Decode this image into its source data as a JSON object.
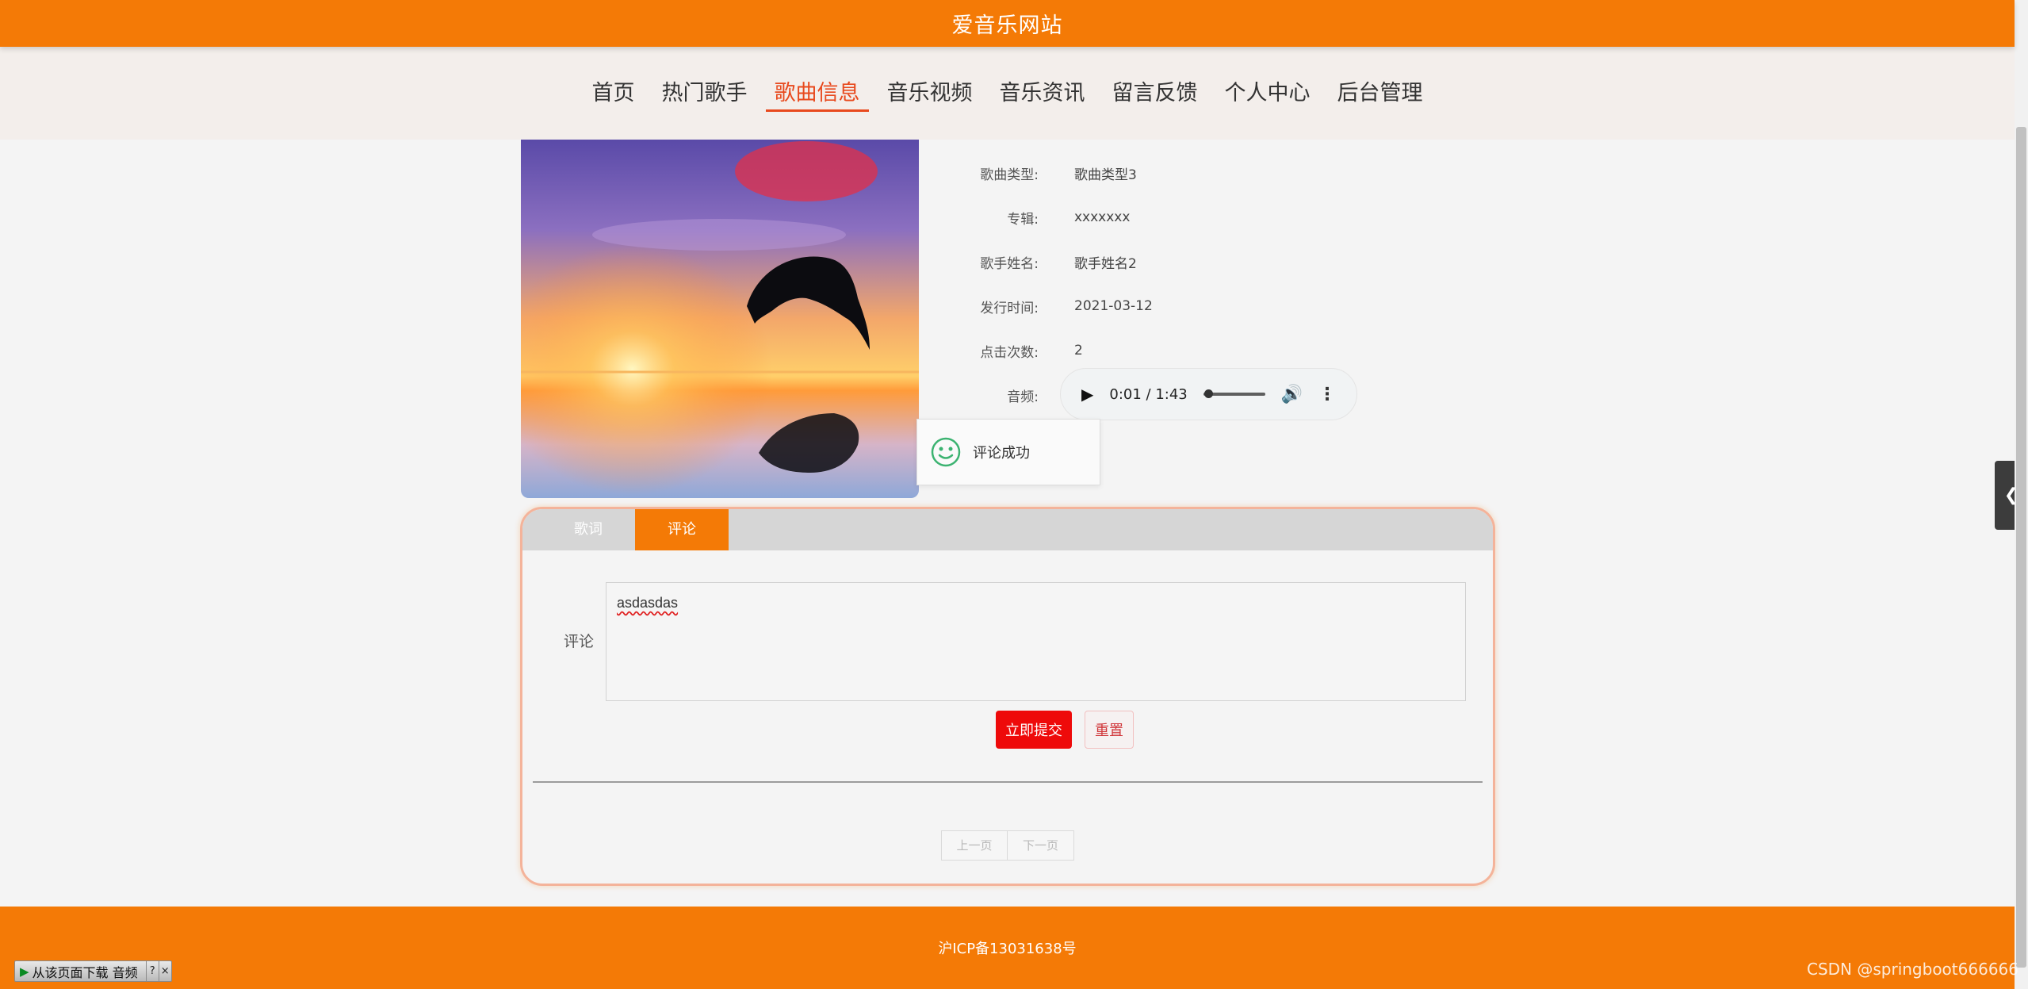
{
  "site": {
    "title": "爱音乐网站"
  },
  "nav": {
    "items": [
      {
        "label": "首页",
        "active": false
      },
      {
        "label": "热门歌手",
        "active": false
      },
      {
        "label": "歌曲信息",
        "active": true
      },
      {
        "label": "音乐视频",
        "active": false
      },
      {
        "label": "音乐资讯",
        "active": false
      },
      {
        "label": "留言反馈",
        "active": false
      },
      {
        "label": "个人中心",
        "active": false
      },
      {
        "label": "后台管理",
        "active": false
      }
    ]
  },
  "song": {
    "fields": [
      {
        "label": "歌曲类型:",
        "value": "歌曲类型3"
      },
      {
        "label": "专辑:",
        "value": "xxxxxxx"
      },
      {
        "label": "歌手姓名:",
        "value": "歌手姓名2"
      },
      {
        "label": "发行时间:",
        "value": "2021-03-12"
      },
      {
        "label": "点击次数:",
        "value": "2"
      }
    ],
    "audio_label": "音频:",
    "audio_time": "0:01 / 1:43",
    "audio_progress": 0.01
  },
  "toast": {
    "message": "评论成功",
    "icon": "smile-icon"
  },
  "tabs": [
    {
      "label": "歌词",
      "active": false
    },
    {
      "label": "评论",
      "active": true
    }
  ],
  "comment": {
    "label": "评论",
    "value": "asdasdas",
    "submit_label": "立即提交",
    "reset_label": "重置"
  },
  "pager": {
    "prev_label": "上一页",
    "next_label": "下一页"
  },
  "footer": {
    "icp": "沪ICP备13031638号"
  },
  "download_bar": {
    "label": "从该页面下载 音频",
    "help": "?",
    "close": "×"
  },
  "watermark": "CSDN @springboot666666",
  "colors": {
    "brand": "#f47a06",
    "active_nav": "#e8491d",
    "submit": "#ee0a0a",
    "toast_icon": "#3cb371"
  }
}
